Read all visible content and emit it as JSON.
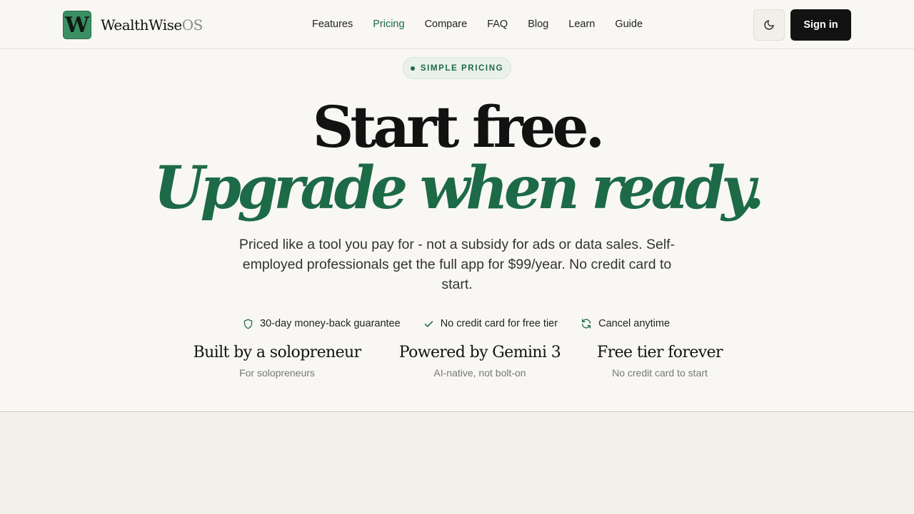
{
  "brand": {
    "mark": "W",
    "name": "WealthWise",
    "suffix": "OS"
  },
  "nav": {
    "items": [
      {
        "label": "Features"
      },
      {
        "label": "Pricing",
        "active": true
      },
      {
        "label": "Compare"
      },
      {
        "label": "FAQ"
      },
      {
        "label": "Blog"
      },
      {
        "label": "Learn"
      },
      {
        "label": "Guide"
      }
    ],
    "theme_toggle_icon": "moon-icon",
    "signin_label": "Sign in"
  },
  "hero": {
    "badge": "SIMPLE PRICING",
    "headline_1": "Start free.",
    "headline_2": "Upgrade when ready.",
    "subtitle": "Priced like a tool you pay for - not a subsidy for ads or data sales. Self-employed professionals get the full app for $99/year. No credit card to start."
  },
  "perks": [
    {
      "icon": "shield-icon",
      "label": "30-day money-back guarantee"
    },
    {
      "icon": "check-icon",
      "label": "No credit card for free tier"
    },
    {
      "icon": "refresh-icon",
      "label": "Cancel anytime"
    }
  ],
  "stats": [
    {
      "title": "Built by a solopreneur",
      "subtitle": "For solopreneurs"
    },
    {
      "title": "Powered by Gemini 3",
      "subtitle": "AI-native, not bolt-on"
    },
    {
      "title": "Free tier forever",
      "subtitle": "No credit card to start"
    }
  ],
  "colors": {
    "accent": "#1d6a46",
    "background": "#f8f7f3",
    "dark_button": "#121212"
  }
}
